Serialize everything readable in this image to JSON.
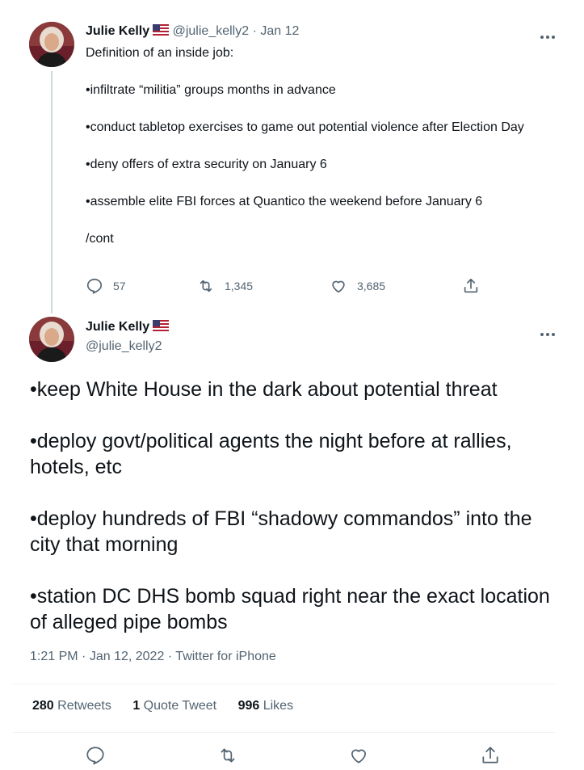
{
  "tweet1": {
    "name": "Julie Kelly",
    "handle": "@julie_kelly2",
    "separator": "·",
    "date": "Jan 12",
    "lines": [
      "Definition of an inside job:",
      "•infiltrate “militia” groups months in advance",
      "•conduct tabletop exercises to game out potential violence after Election Day",
      "•deny offers of extra security on January 6",
      "•assemble elite FBI forces at Quantico the weekend before January 6",
      "/cont"
    ],
    "replies": "57",
    "retweets": "1,345",
    "likes": "3,685"
  },
  "tweet2": {
    "name": "Julie Kelly",
    "handle": "@julie_kelly2",
    "lines": [
      "•keep White House in the dark about potential threat",
      "•deploy govt/political agents the night before at rallies, hotels, etc",
      "•deploy hundreds of FBI “shadowy commandos” into the city that morning",
      "•station DC DHS bomb squad right near the exact location of alleged pipe bombs"
    ],
    "time": "1:21 PM",
    "date": "Jan 12, 2022",
    "source": "Twitter for iPhone",
    "retweets_count": "280",
    "retweets_label": "Retweets",
    "quote_count": "1",
    "quote_label": "Quote Tweet",
    "likes_count": "996",
    "likes_label": "Likes"
  },
  "colors": {
    "text": "#0f1419",
    "secondary": "#536471",
    "divider": "#eff3f4",
    "thread_line": "#cfd9de"
  },
  "icons": [
    "reply-icon",
    "retweet-icon",
    "like-icon",
    "share-icon",
    "more-icon",
    "us-flag-icon"
  ]
}
